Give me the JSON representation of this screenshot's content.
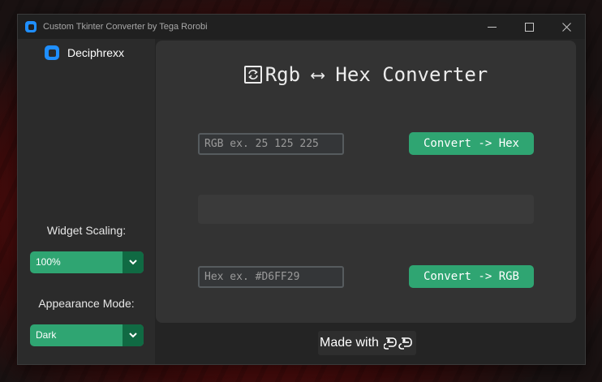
{
  "window": {
    "title": "Custom Tkinter Converter by Tega Rorobi",
    "controls": {
      "minimize": "—",
      "maximize": "☐",
      "close": "✕"
    }
  },
  "sidebar": {
    "brand": "Deciphrexx",
    "widget_scaling": {
      "label": "Widget Scaling:",
      "value": "100%"
    },
    "appearance_mode": {
      "label": "Appearance Mode:",
      "value": "Dark"
    }
  },
  "main": {
    "heading": "Rgb ⟷ Hex Converter",
    "rgb_input": {
      "placeholder": "RGB ex. 25 125 225",
      "value": ""
    },
    "to_hex_button": "Convert -> Hex",
    "result": "",
    "hex_input": {
      "placeholder": "Hex ex. #D6FF29",
      "value": ""
    },
    "to_rgb_button": "Convert -> RGB"
  },
  "footer": {
    "made_with": "Made with"
  },
  "colors": {
    "accent": "#2fa572",
    "accent_dark": "#106a43",
    "window_bg": "#242424",
    "sidebar_bg": "#2b2b2b",
    "panel_bg": "#333333",
    "brand_icon": "#1f8fff"
  },
  "icons": {
    "app": "app-logo-icon",
    "brand": "brand-logo-icon",
    "heading": "convert-arrows-icon",
    "dropdown": "chevron-down-icon",
    "footer": "python-icon"
  }
}
